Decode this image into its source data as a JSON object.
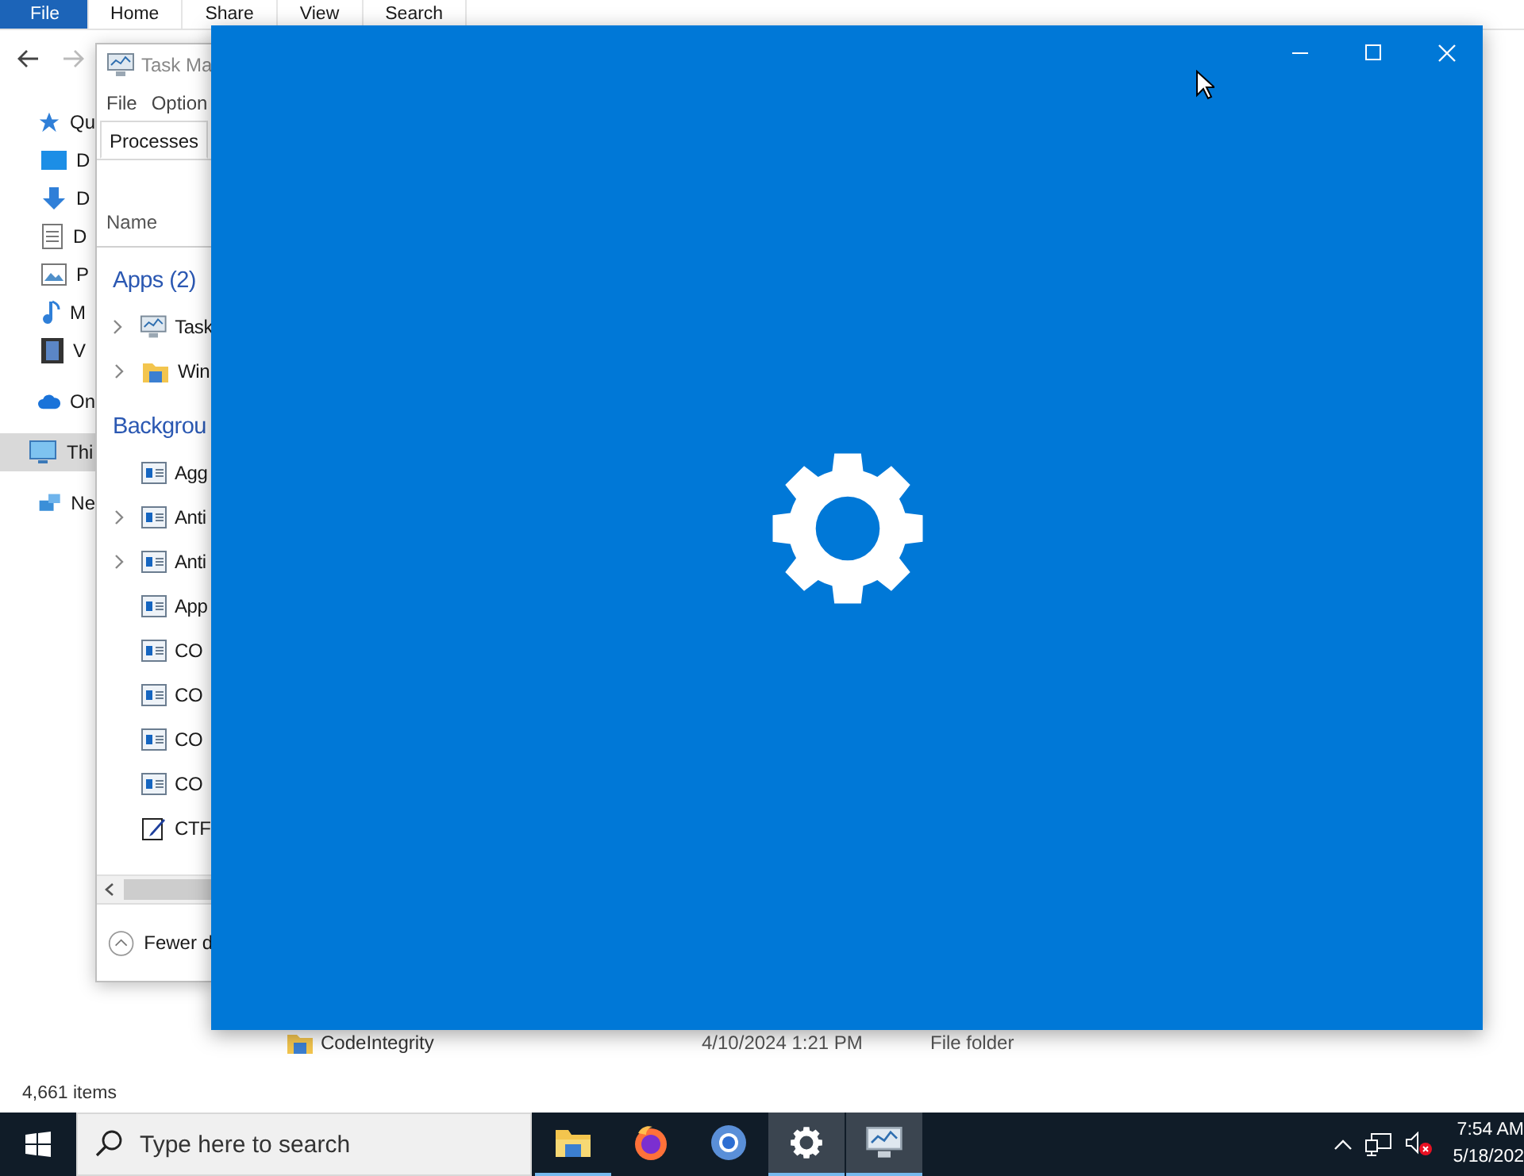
{
  "explorer": {
    "ribbon_tabs": [
      {
        "label": "File",
        "selected": true
      },
      {
        "label": "Home",
        "selected": false
      },
      {
        "label": "Share",
        "selected": false
      },
      {
        "label": "View",
        "selected": false
      },
      {
        "label": "Search",
        "selected": false
      }
    ],
    "nav_items": [
      {
        "label": "Qu",
        "kind": "star",
        "selected": false
      },
      {
        "label": "D",
        "kind": "desktop",
        "selected": false
      },
      {
        "label": "D",
        "kind": "download",
        "selected": false
      },
      {
        "label": "D",
        "kind": "document",
        "selected": false
      },
      {
        "label": "P",
        "kind": "pictures",
        "selected": false
      },
      {
        "label": "M",
        "kind": "music",
        "selected": false
      },
      {
        "label": "V",
        "kind": "video",
        "selected": false
      },
      {
        "label": "On",
        "kind": "cloud",
        "selected": false
      },
      {
        "label": "Thi",
        "kind": "pc",
        "selected": true
      },
      {
        "label": "Ne",
        "kind": "network",
        "selected": false
      }
    ],
    "file_row": {
      "name": "CodeIntegrity",
      "date": "4/10/2024 1:21 PM",
      "type": "File folder"
    },
    "status_bar": "4,661 items"
  },
  "task_manager": {
    "title": "Task Ma",
    "menu": [
      "File",
      "Option"
    ],
    "tabs": [
      {
        "label": "Processes",
        "selected": true
      }
    ],
    "column": "Name",
    "groups": [
      {
        "label": "Apps (2)",
        "items": [
          {
            "label": "Task",
            "kind": "taskmgr",
            "expandable": true
          },
          {
            "label": "Win",
            "kind": "explorer",
            "expandable": true
          }
        ]
      },
      {
        "label": "Backgrou",
        "items": [
          {
            "label": "Agg",
            "kind": "service",
            "expandable": false
          },
          {
            "label": "Anti",
            "kind": "service",
            "expandable": true
          },
          {
            "label": "Anti",
            "kind": "service",
            "expandable": true
          },
          {
            "label": "App",
            "kind": "service",
            "expandable": false
          },
          {
            "label": "CO",
            "kind": "service",
            "expandable": false
          },
          {
            "label": "CO",
            "kind": "service",
            "expandable": false
          },
          {
            "label": "CO",
            "kind": "service",
            "expandable": false
          },
          {
            "label": "CO",
            "kind": "service",
            "expandable": false
          },
          {
            "label": "CTF",
            "kind": "notepad",
            "expandable": false
          }
        ]
      }
    ],
    "footer": "Fewer d"
  },
  "taskbar": {
    "search": {
      "placeholder": "Type here to search"
    },
    "apps": [
      {
        "kind": "explorer",
        "open": true,
        "highlighted": false
      },
      {
        "kind": "firefox",
        "open": false,
        "highlighted": false
      },
      {
        "kind": "chrome",
        "open": false,
        "highlighted": false
      },
      {
        "kind": "settings",
        "open": true,
        "highlighted": true
      },
      {
        "kind": "taskmgr",
        "open": true,
        "highlighted": true
      }
    ],
    "time": "7:54 AM",
    "date": "5/18/202"
  }
}
